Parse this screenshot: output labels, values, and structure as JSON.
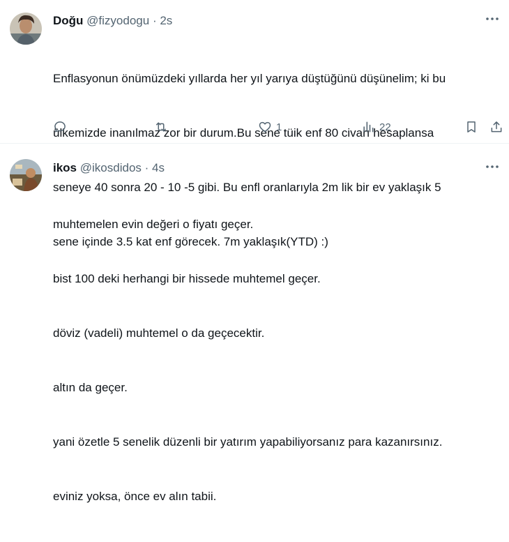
{
  "tweets": [
    {
      "author": {
        "name": "Doğu",
        "handle": "@fizyodogu"
      },
      "separator": "·",
      "time": "2s",
      "more_icon": "more-horizontal-icon",
      "lines": [
        "Enflasyonun önümüzdeki yıllarda her yıl yarıya düştüğünü düşünelim; ki bu",
        "ülkemizde inanılmaz zor bir durum.Bu sene tüik enf 80 civarı hesaplansa",
        "seneye 40 sonra 20 - 10 -5 gibi. Bu enfl oranlarıyla 2m lik bir ev yaklaşık 5",
        "sene içinde 3.5 kat enf görecek. 7m yaklaşık(YTD) :)"
      ],
      "actions": {
        "reply": "",
        "retweet": "",
        "like": "1",
        "views": "22"
      }
    },
    {
      "author": {
        "name": "ikos",
        "handle": "@ikosdidos"
      },
      "separator": "·",
      "time": "4s",
      "more_icon": "more-horizontal-icon",
      "lines": [
        "muhtemelen evin değeri o fiyatı geçer.",
        "bist 100 deki herhangi bir hissede muhtemel geçer.",
        "döviz (vadeli) muhtemel o da geçecektir.",
        "altın da geçer.",
        "yani özetle 5 senelik düzenli bir yatırım yapabiliyorsanız para kazanırsınız.",
        "eviniz yoksa, önce ev alın tabii."
      ]
    }
  ],
  "colors": {
    "text": "#0f1419",
    "secondary": "#536471",
    "divider": "#eff3f4"
  }
}
